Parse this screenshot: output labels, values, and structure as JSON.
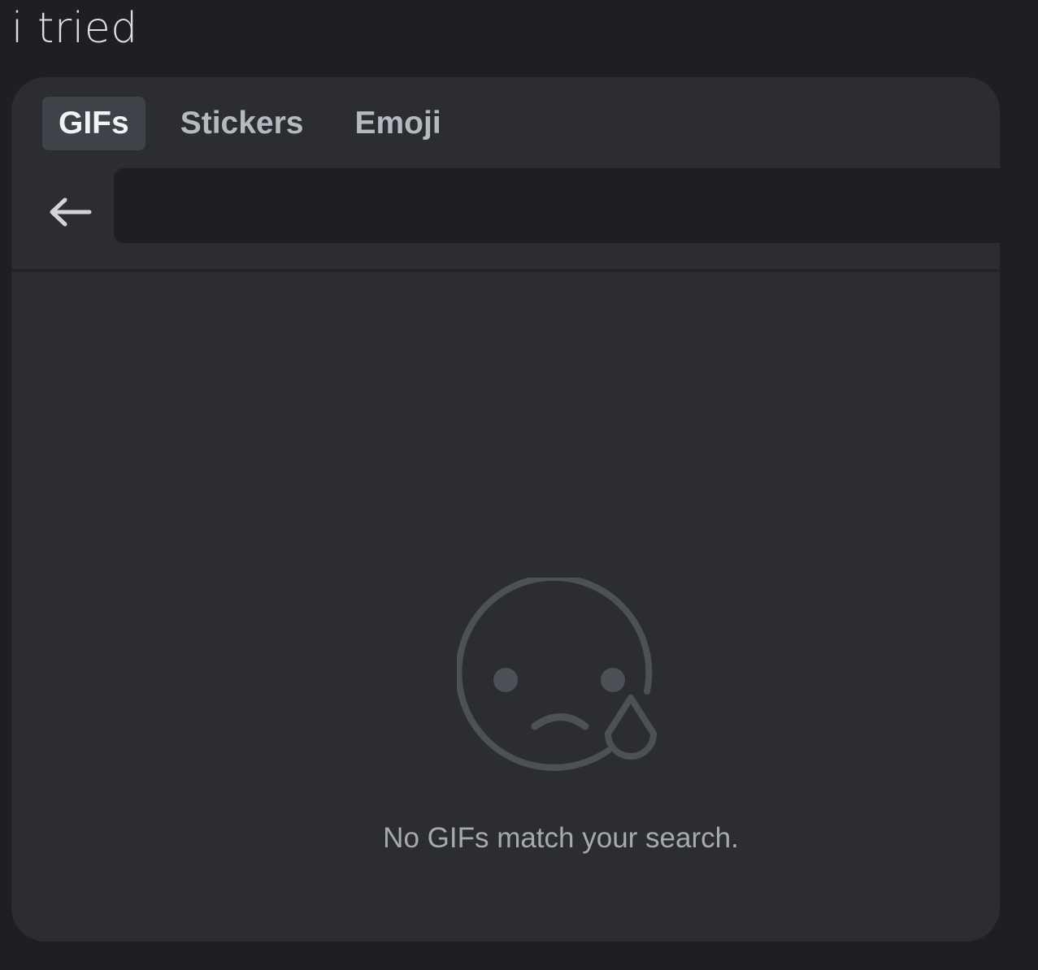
{
  "message": {
    "text": "i tried"
  },
  "picker": {
    "tabs": [
      {
        "label": "GIFs",
        "active": true
      },
      {
        "label": "Stickers",
        "active": false
      },
      {
        "label": "Emoji",
        "active": false
      }
    ],
    "search": {
      "value": "",
      "back_icon": "arrow-left-icon"
    },
    "empty_state": {
      "icon": "sad-tear-face-icon",
      "message": "No GIFs match your search."
    }
  },
  "colors": {
    "page_background": "#1e1f24",
    "picker_background": "#2b2d31",
    "active_tab_background": "#404249",
    "search_background": "#1e1f22",
    "icon_stroke": "#4e5058",
    "muted_text": "#a6a9ae"
  }
}
